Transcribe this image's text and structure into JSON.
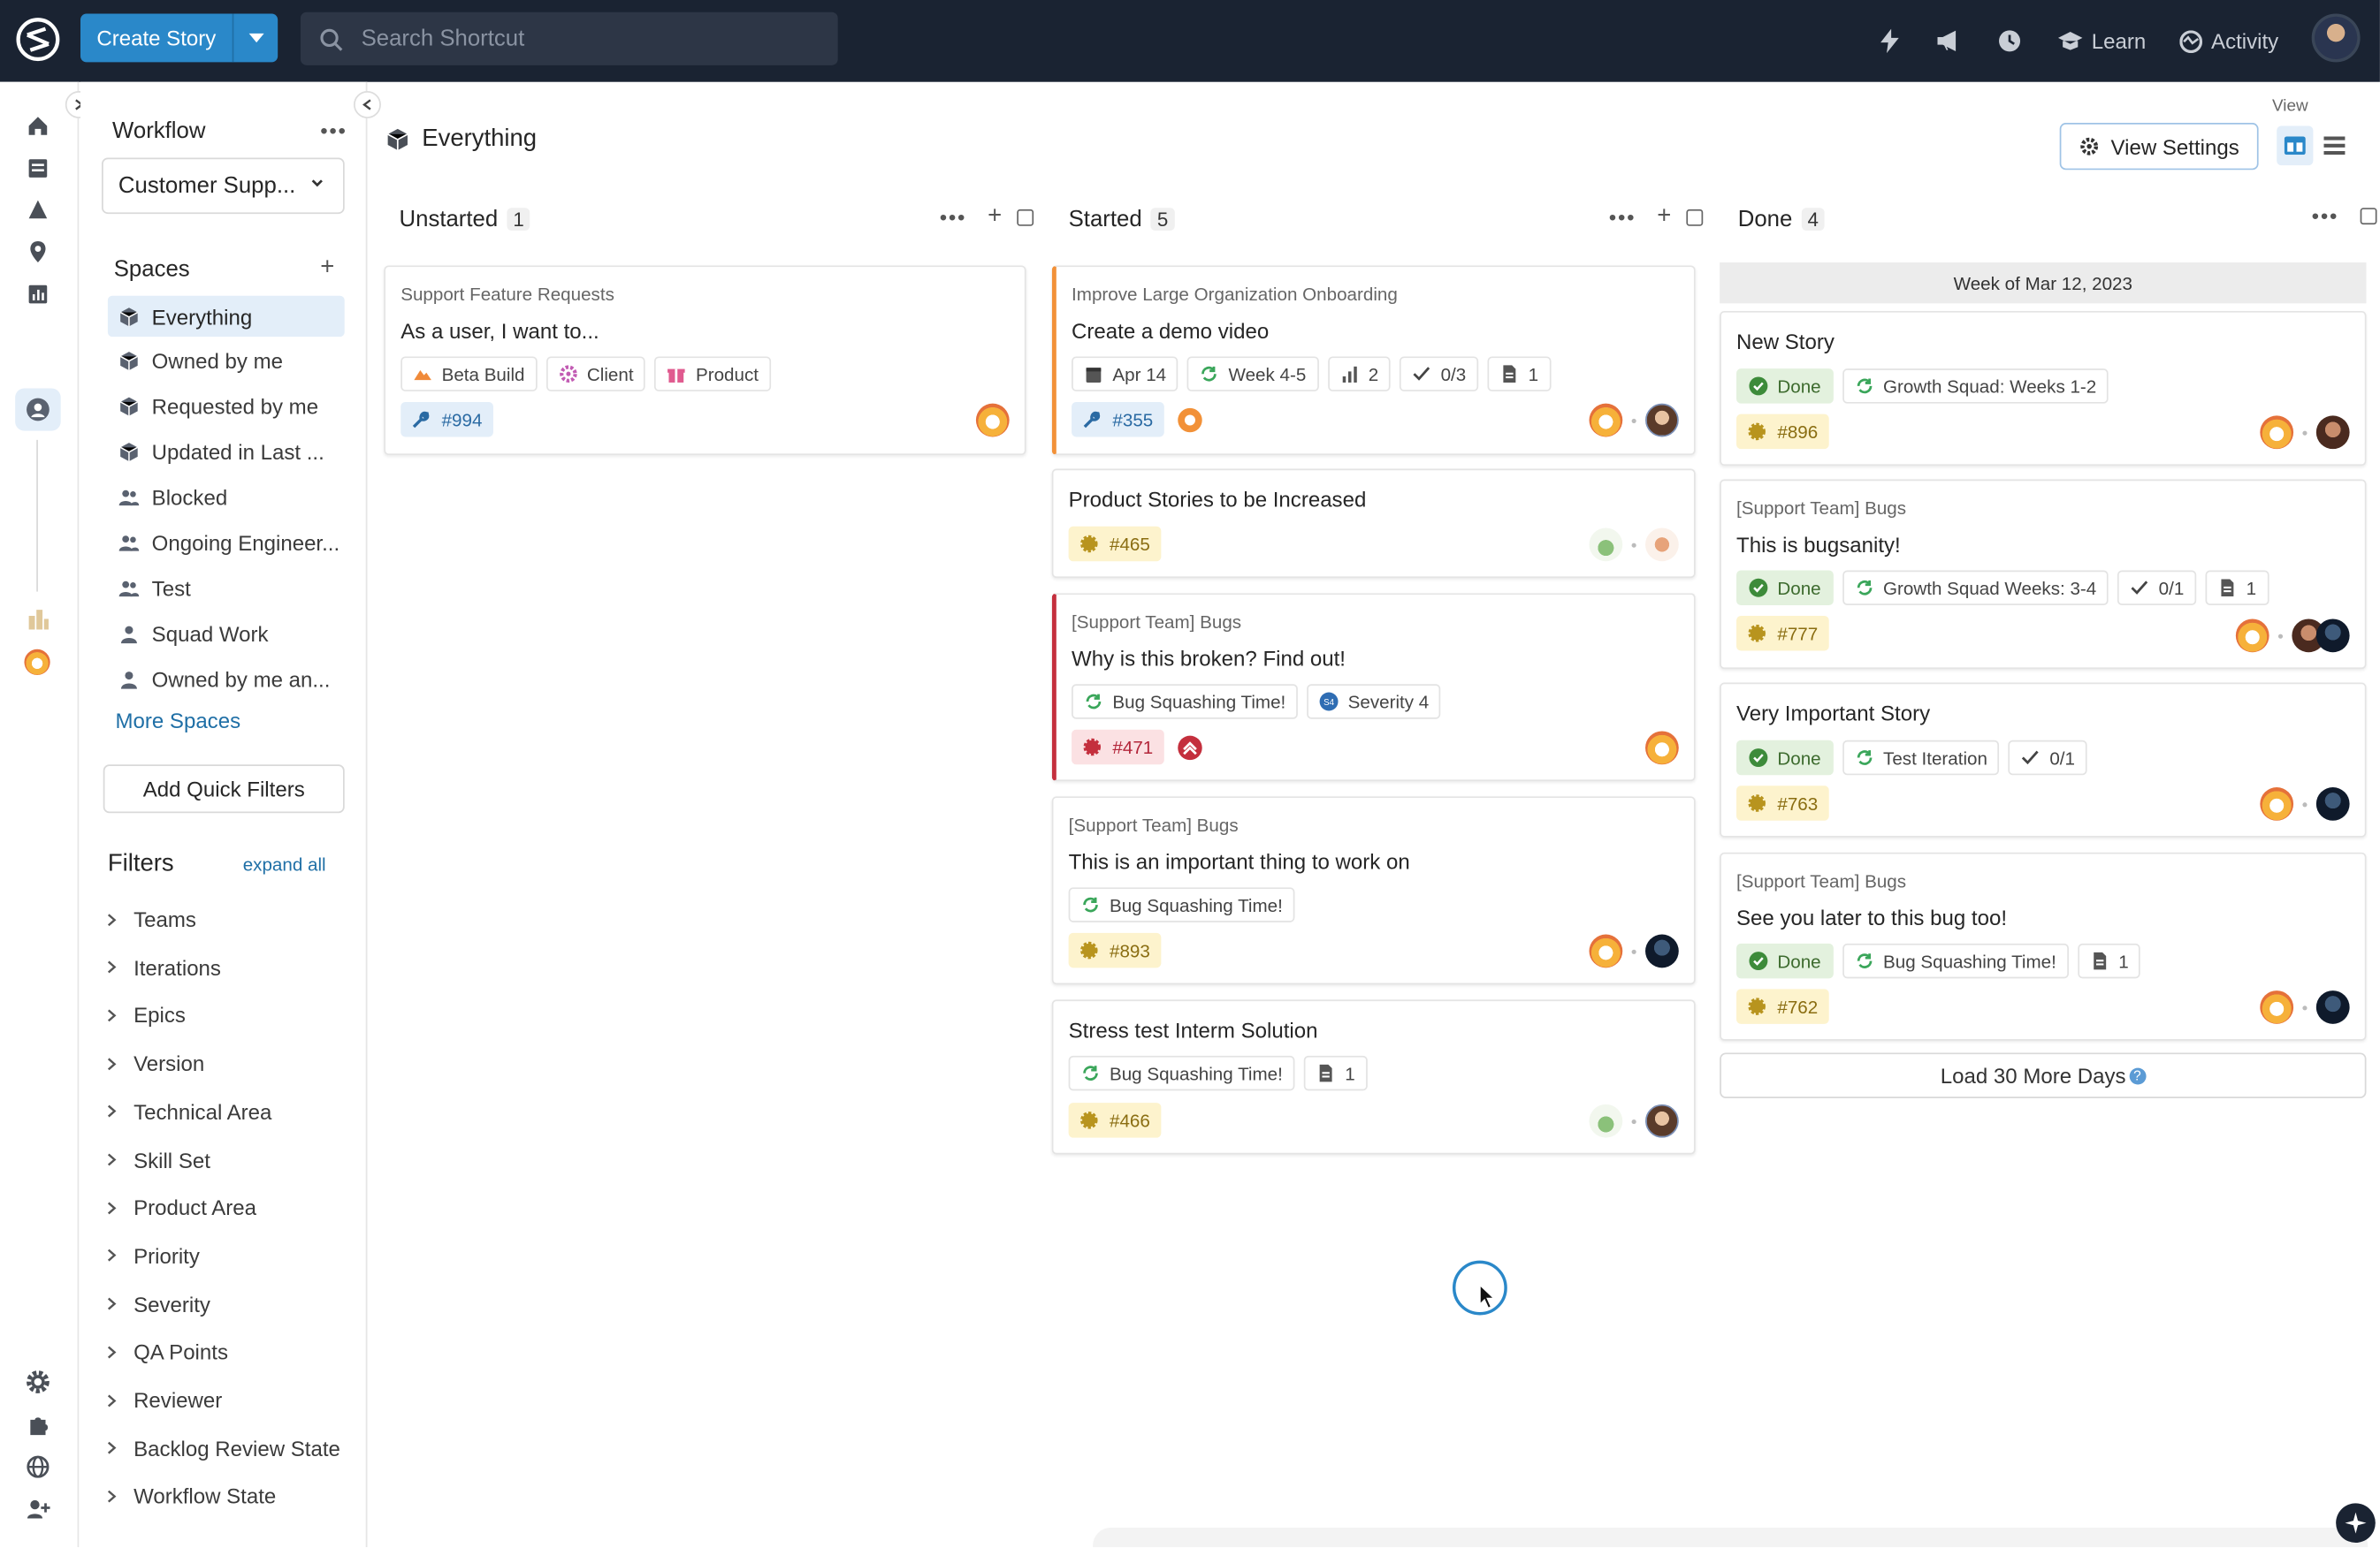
{
  "topbar": {
    "create_label": "Create Story",
    "search_placeholder": "Search Shortcut",
    "learn_label": "Learn",
    "activity_label": "Activity"
  },
  "sidebar": {
    "title": "Workflow",
    "workflow_selected": "Customer Supp...",
    "spaces_label": "Spaces",
    "spaces": [
      {
        "label": "Everything",
        "icon": "cube-icon",
        "active": true
      },
      {
        "label": "Owned by me",
        "icon": "cube-icon"
      },
      {
        "label": "Requested by me",
        "icon": "cube-icon"
      },
      {
        "label": "Updated in Last ...",
        "icon": "cube-icon"
      },
      {
        "label": "Blocked",
        "icon": "users-icon"
      },
      {
        "label": "Ongoing Engineer...",
        "icon": "users-icon"
      },
      {
        "label": "Test",
        "icon": "users-icon"
      },
      {
        "label": "Squad Work",
        "icon": "user-icon"
      },
      {
        "label": "Owned by me an...",
        "icon": "user-icon"
      }
    ],
    "more_spaces": "More Spaces",
    "add_quick_filters": "Add Quick Filters",
    "filters_label": "Filters",
    "expand_all": "expand all",
    "filters": [
      "Teams",
      "Iterations",
      "Epics",
      "Version",
      "Technical Area",
      "Skill Set",
      "Product Area",
      "Priority",
      "Severity",
      "QA Points",
      "Reviewer",
      "Backlog Review State",
      "Workflow State"
    ]
  },
  "main": {
    "page_title": "Everything",
    "view_label": "View",
    "view_settings": "View Settings",
    "columns": [
      {
        "name": "Unstarted",
        "count": "1"
      },
      {
        "name": "Started",
        "count": "5"
      },
      {
        "name": "Done",
        "count": "4"
      }
    ],
    "unstarted_cards": [
      {
        "epic": "Support Feature Requests",
        "title": "As a user, I want to...",
        "labels": [
          "Beta Build",
          "Client",
          "Product"
        ],
        "id": "#994"
      }
    ],
    "started_cards": [
      {
        "epic": "Improve Large Organization Onboarding",
        "title": "Create a demo video",
        "date": "Apr 14",
        "iteration": "Week 4-5",
        "estimate": "2",
        "tasks": "0/3",
        "docs": "1",
        "id": "#355"
      },
      {
        "title": "Product Stories to be Increased",
        "id": "#465"
      },
      {
        "epic": "[Support Team] Bugs",
        "title": "Why is this broken? Find out!",
        "iteration": "Bug Squashing Time!",
        "severity": "Severity 4",
        "id": "#471"
      },
      {
        "epic": "[Support Team] Bugs",
        "title": "This is an important thing to work on",
        "iteration": "Bug Squashing Time!",
        "id": "#893"
      },
      {
        "title": "Stress test Interm Solution",
        "iteration": "Bug Squashing Time!",
        "docs": "1",
        "id": "#466"
      }
    ],
    "done_week": "Week of Mar 12, 2023",
    "done_cards": [
      {
        "title": "New Story",
        "state": "Done",
        "iteration": "Growth Squad: Weeks 1-2",
        "id": "#896"
      },
      {
        "epic": "[Support Team] Bugs",
        "title": "This is bugsanity!",
        "state": "Done",
        "iteration": "Growth Squad Weeks: 3-4",
        "tasks": "0/1",
        "docs": "1",
        "id": "#777"
      },
      {
        "title": "Very Important Story",
        "state": "Done",
        "iteration": "Test Iteration",
        "tasks": "0/1",
        "id": "#763"
      },
      {
        "epic": "[Support Team] Bugs",
        "title": "See you later to this bug too!",
        "state": "Done",
        "iteration": "Bug Squashing Time!",
        "docs": "1",
        "id": "#762"
      }
    ],
    "load_more": "Load 30 More Days"
  },
  "colors": {
    "topbar_bg": "#1a2332",
    "accent_blue": "#2a88c9",
    "done_green": "#3d6b2e",
    "bug_red": "#c42f3d",
    "started_orange": "#f29138"
  }
}
